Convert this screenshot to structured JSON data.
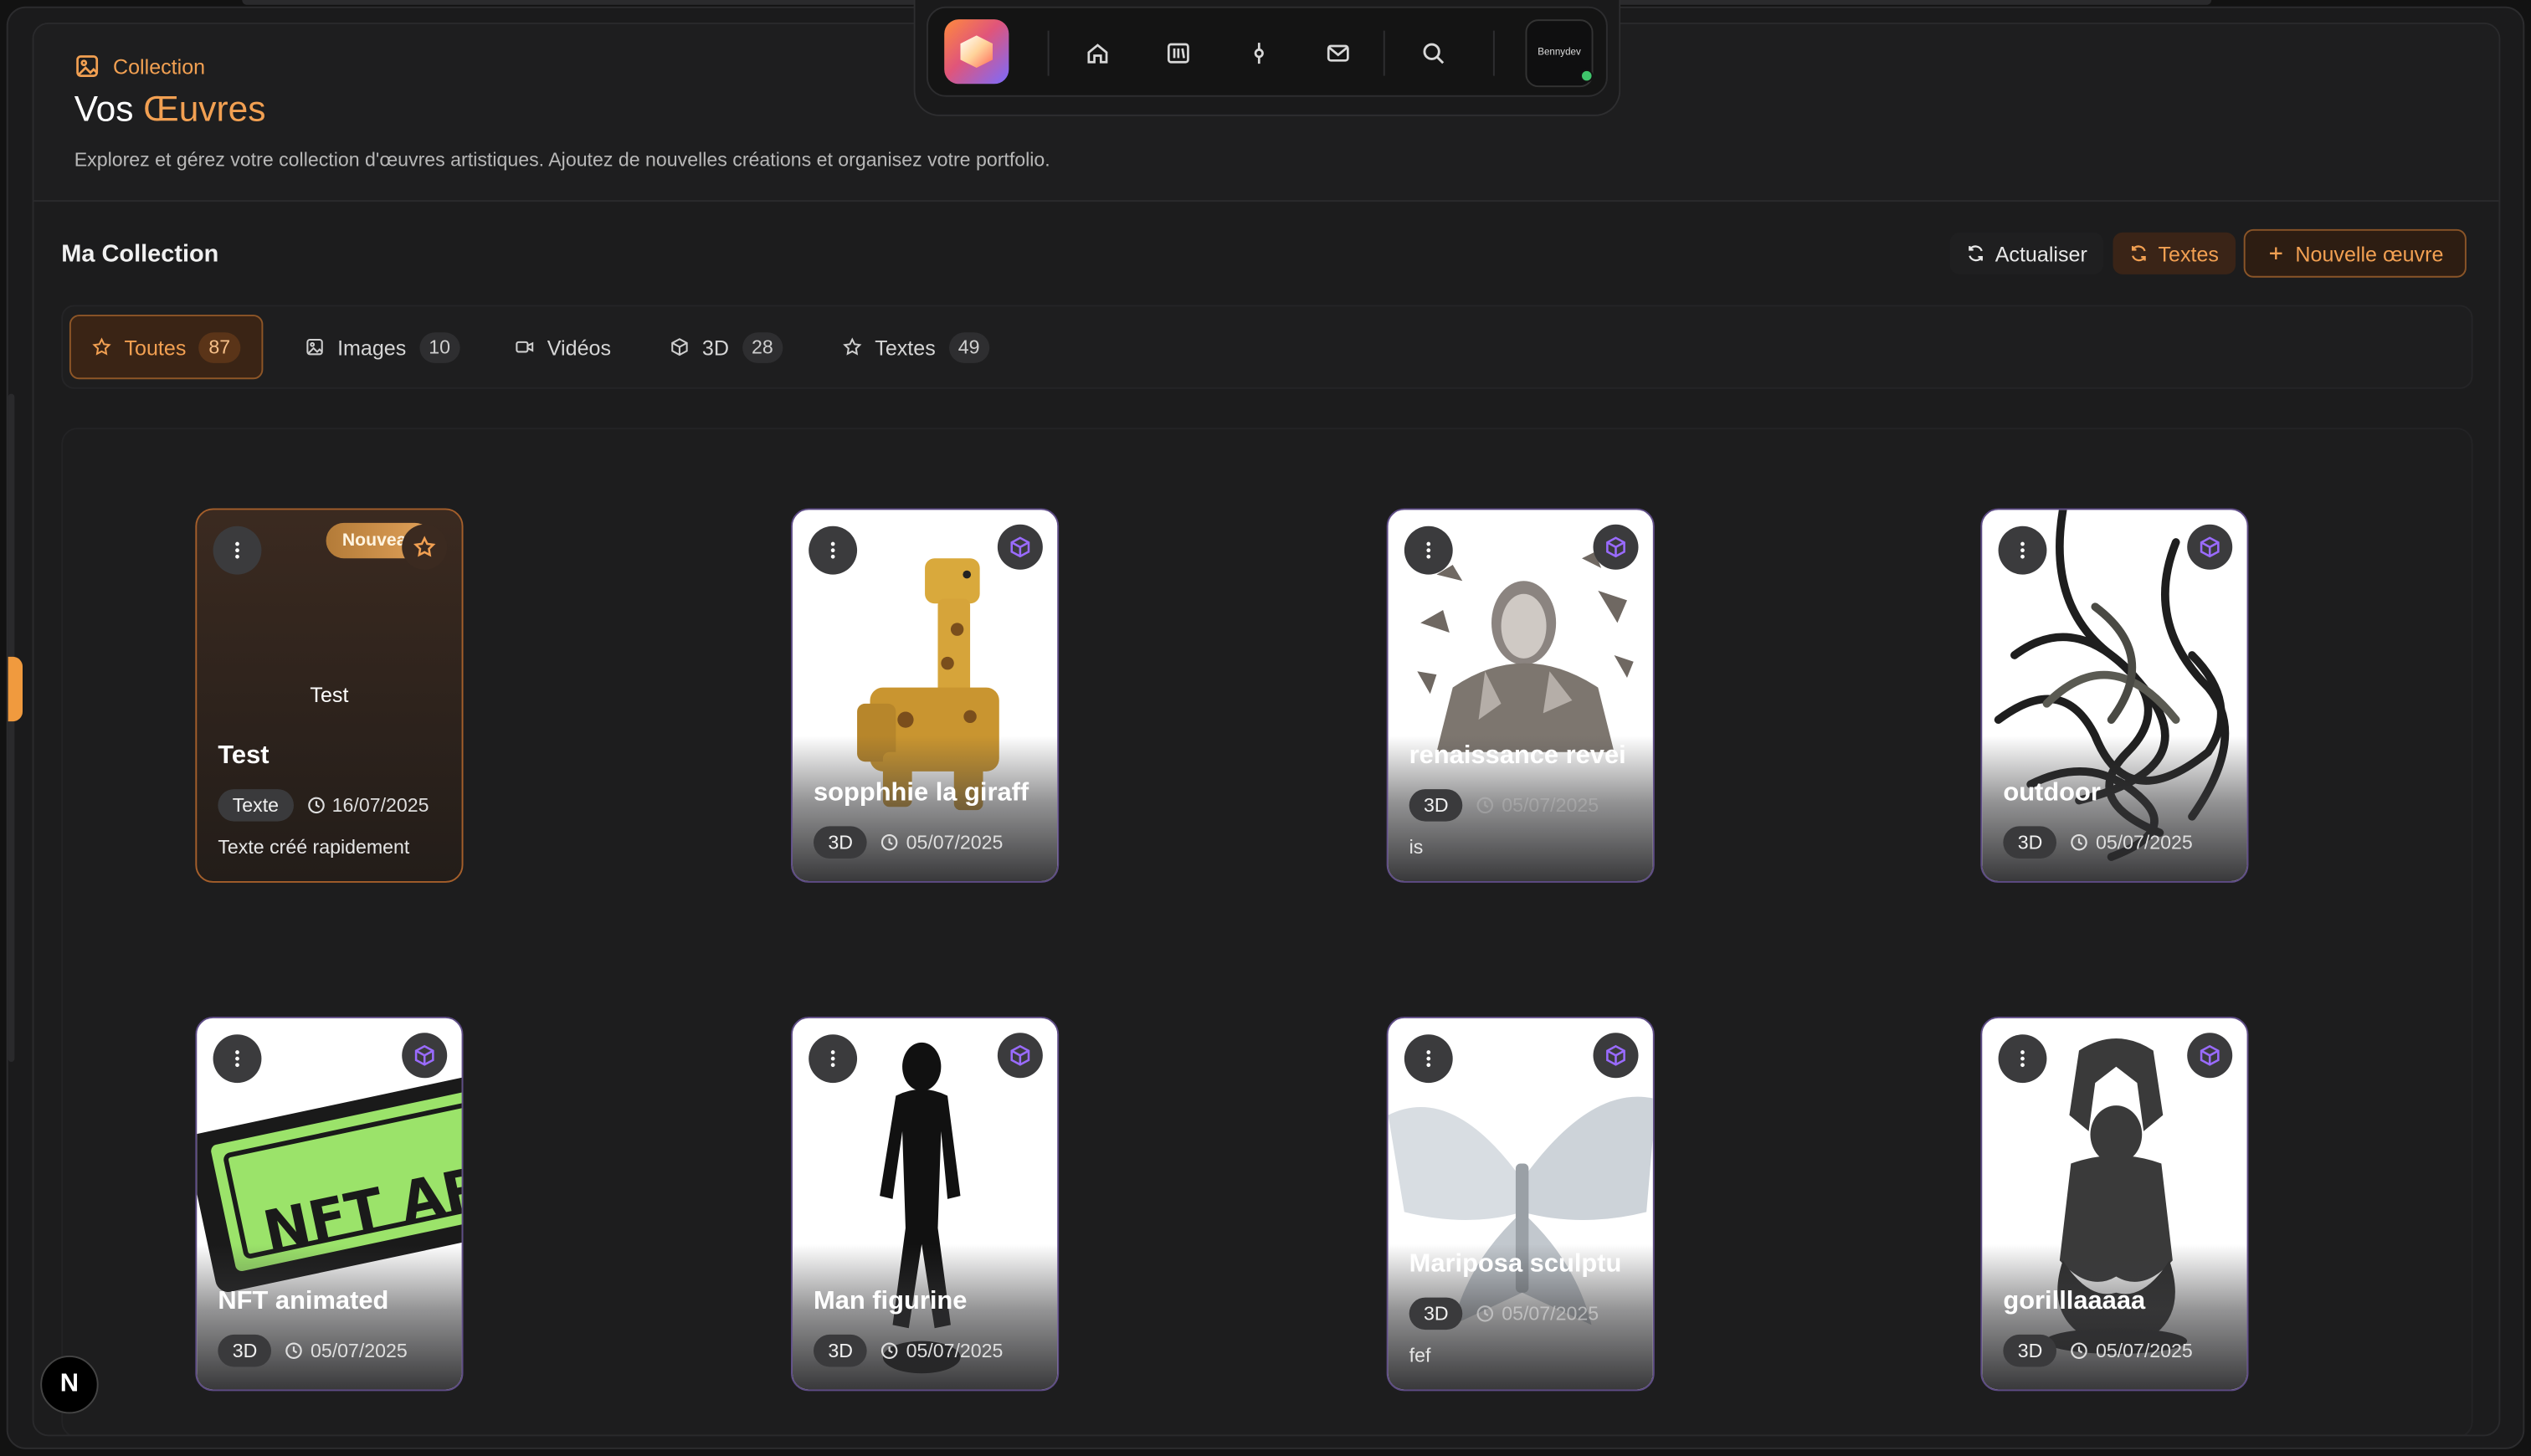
{
  "header": {
    "breadcrumb": "Collection",
    "title_prefix": "Vos ",
    "title_accent": "Œuvres",
    "description": "Explorez et gérez votre collection d'œuvres artistiques. Ajoutez de nouvelles créations et organisez votre portfolio."
  },
  "dock": {
    "items": [
      "home-icon",
      "library-icon",
      "commit-icon",
      "mail-icon",
      "search-icon"
    ],
    "avatar_label": "Bennydev"
  },
  "toolbar": {
    "title": "Ma Collection",
    "refresh_label": "Actualiser",
    "texts_label": "Textes",
    "new_label": "Nouvelle œuvre"
  },
  "tabs": [
    {
      "label": "Toutes",
      "count": "87",
      "active": true
    },
    {
      "label": "Images",
      "count": "10"
    },
    {
      "label": "Vidéos",
      "count": ""
    },
    {
      "label": "3D",
      "count": "28"
    },
    {
      "label": "Textes",
      "count": "49"
    }
  ],
  "cards": [
    {
      "title": "Test",
      "type": "Texte",
      "date": "16/07/2025",
      "desc": "Texte créé rapidement",
      "badge": "Nouveau",
      "body": "Test"
    },
    {
      "title": "sopphhie la giraff",
      "type": "3D",
      "date": "05/07/2025",
      "desc": ""
    },
    {
      "title": "renaissance revei",
      "type": "3D",
      "date": "05/07/2025",
      "desc": "is"
    },
    {
      "title": "outdoor",
      "type": "3D",
      "date": "05/07/2025",
      "desc": ""
    },
    {
      "title": "NFT animated",
      "type": "3D",
      "date": "05/07/2025",
      "desc": "",
      "art_text": "NFT ART"
    },
    {
      "title": "Man figurine",
      "type": "3D",
      "date": "05/07/2025",
      "desc": ""
    },
    {
      "title": "Mariposa sculptu",
      "type": "3D",
      "date": "05/07/2025",
      "desc": "fef"
    },
    {
      "title": "gorilllaaaaa",
      "type": "3D",
      "date": "05/07/2025",
      "desc": ""
    }
  ],
  "colors": {
    "accent": "#f2a052",
    "background": "#1c1c1d",
    "purple": "#9a6bff"
  },
  "framework_badge": "N"
}
